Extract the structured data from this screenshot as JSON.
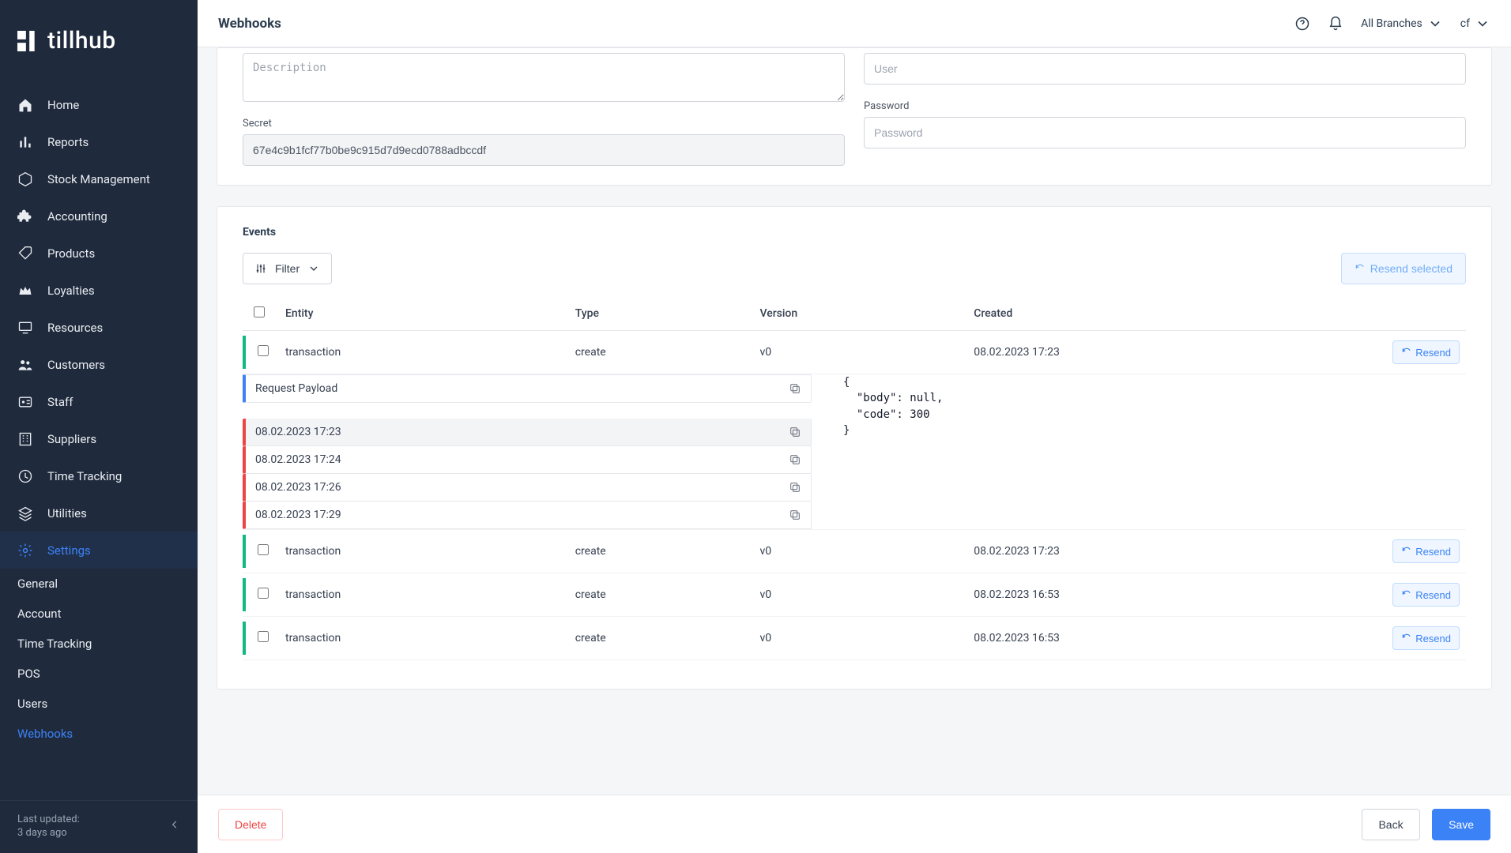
{
  "brand": "tillhub",
  "sidebar": {
    "items": [
      {
        "label": "Home"
      },
      {
        "label": "Reports"
      },
      {
        "label": "Stock Management"
      },
      {
        "label": "Accounting"
      },
      {
        "label": "Products"
      },
      {
        "label": "Loyalties"
      },
      {
        "label": "Resources"
      },
      {
        "label": "Customers"
      },
      {
        "label": "Staff"
      },
      {
        "label": "Suppliers"
      },
      {
        "label": "Time Tracking"
      },
      {
        "label": "Utilities"
      },
      {
        "label": "Settings"
      }
    ],
    "sub": [
      {
        "label": "General"
      },
      {
        "label": "Account"
      },
      {
        "label": "Time Tracking"
      },
      {
        "label": "POS"
      },
      {
        "label": "Users"
      },
      {
        "label": "Webhooks"
      }
    ],
    "footer_line1": "Last updated:",
    "footer_line2": "3 days ago"
  },
  "header": {
    "title": "Webhooks",
    "branches": "All Branches",
    "user": "cf"
  },
  "form": {
    "description_placeholder": "Description",
    "secret_label": "Secret",
    "secret_value": "67e4c9b1fcf77b0be9c915d7d9ecd0788adbccdf",
    "user_placeholder": "User",
    "password_label": "Password",
    "password_placeholder": "Password"
  },
  "events": {
    "title": "Events",
    "filter_label": "Filter",
    "resend_selected": "Resend selected",
    "resend_label": "Resend",
    "columns": {
      "entity": "Entity",
      "type": "Type",
      "version": "Version",
      "created": "Created"
    },
    "rows": [
      {
        "entity": "transaction",
        "type": "create",
        "version": "v0",
        "created": "08.02.2023 17:23"
      },
      {
        "entity": "transaction",
        "type": "create",
        "version": "v0",
        "created": "08.02.2023 17:23"
      },
      {
        "entity": "transaction",
        "type": "create",
        "version": "v0",
        "created": "08.02.2023 16:53"
      },
      {
        "entity": "transaction",
        "type": "create",
        "version": "v0",
        "created": "08.02.2023 16:53"
      }
    ],
    "detail": {
      "payload_label": "Request Payload",
      "attempts": [
        "08.02.2023 17:23",
        "08.02.2023 17:24",
        "08.02.2023 17:26",
        "08.02.2023 17:29"
      ],
      "response": "{\n  \"body\": null,\n  \"code\": 300\n}"
    }
  },
  "footer": {
    "delete": "Delete",
    "back": "Back",
    "save": "Save"
  }
}
